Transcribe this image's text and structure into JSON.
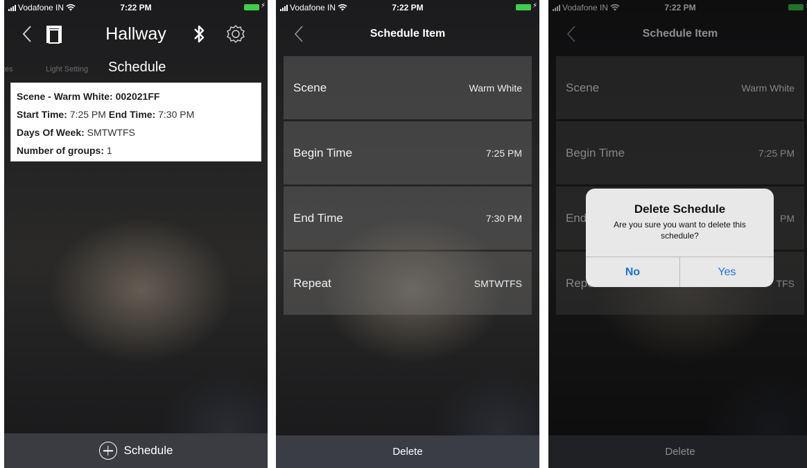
{
  "status_bar": {
    "carrier": "Vodafone IN",
    "time": "7:22 PM",
    "bolt": "⚡"
  },
  "screen1": {
    "title": "Hallway",
    "tabs": [
      "tes",
      "Light Setting",
      "Schedule"
    ],
    "schedule_card": {
      "scene": "Scene - Warm White: 002021FF",
      "start_label": "Start Time:",
      "start_value": "7:25 PM",
      "end_label": "End Time:",
      "end_value": "7:30 PM",
      "days_label": "Days Of Week:",
      "days_value": "SMTWTFS",
      "groups_label": "Number of groups:",
      "groups_value": "1"
    },
    "add_button_label": "Schedule"
  },
  "screen2": {
    "title": "Schedule Item",
    "rows": [
      {
        "label": "Scene",
        "value": "Warm White"
      },
      {
        "label": "Begin Time",
        "value": "7:25 PM"
      },
      {
        "label": "End Time",
        "value": "7:30 PM"
      },
      {
        "label": "Repeat",
        "value": "SMTWTFS"
      }
    ],
    "delete_label": "Delete"
  },
  "screen3": {
    "title": "Schedule Item",
    "rows": [
      {
        "label": "Scene",
        "value": "Warm White"
      },
      {
        "label": "Begin Time",
        "value": "7:25 PM"
      },
      {
        "label": "End",
        "value": "PM"
      },
      {
        "label": "Repe",
        "value": "TFS"
      }
    ],
    "delete_label": "Delete",
    "alert": {
      "title": "Delete Schedule",
      "message": "Are you sure you want to delete this schedule?",
      "no_label": "No",
      "yes_label": "Yes"
    }
  },
  "colors": {
    "accent": "#1a73d9",
    "battery": "#3fd04a",
    "bottom_bar": "#3a3c42"
  },
  "icons": [
    "back-chevron-icon",
    "door-icon",
    "bluetooth-icon",
    "gear-icon",
    "plus-circle-icon",
    "signal-icon",
    "wifi-icon",
    "battery-icon"
  ]
}
